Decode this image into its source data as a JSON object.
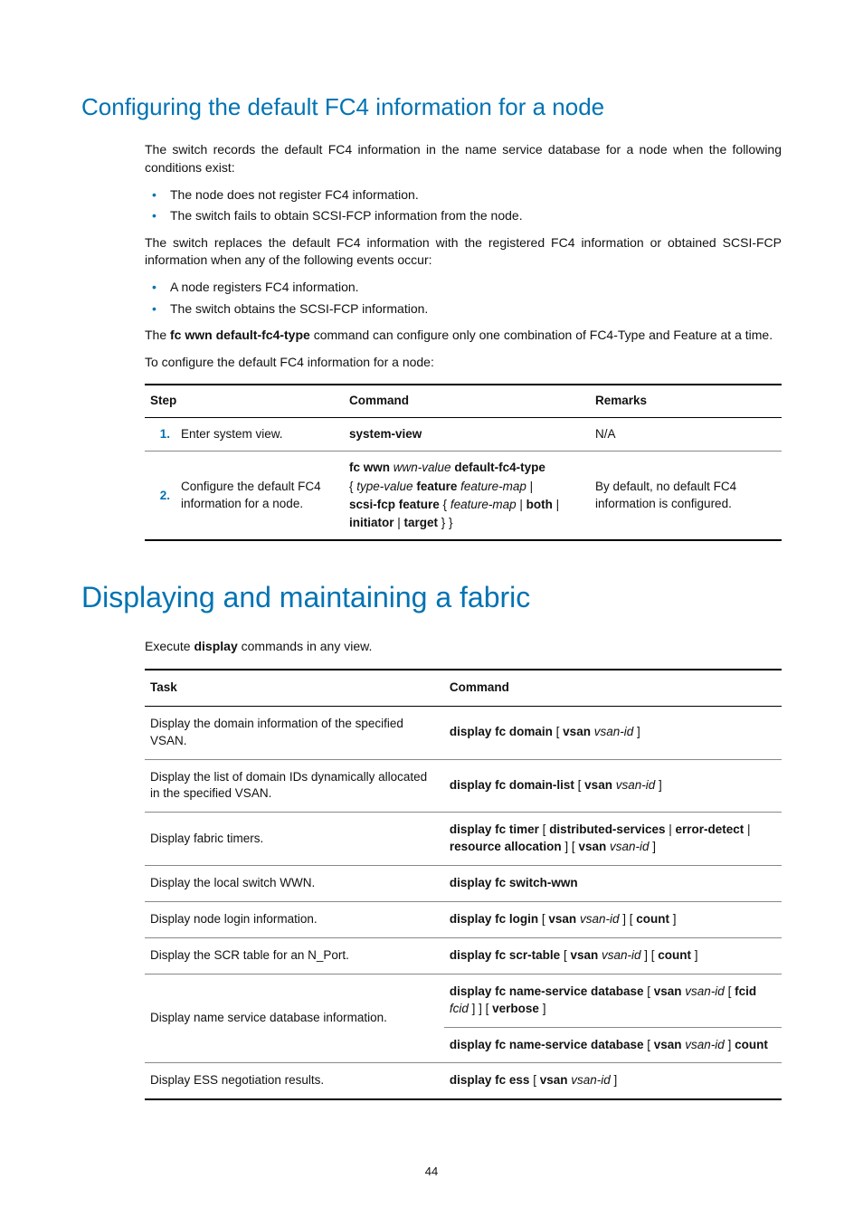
{
  "section1": {
    "title": "Configuring the default FC4 information for a node",
    "p1": "The switch records the default FC4 information in the name service database for a node when the following conditions exist:",
    "b1": "The node does not register FC4 information.",
    "b2": "The switch fails to obtain SCSI-FCP information from the node.",
    "p2": "The switch replaces the default FC4 information with the registered FC4 information or obtained SCSI-FCP information when any of the following events occur:",
    "b3": "A node registers FC4 information.",
    "b4": "The switch obtains the SCSI-FCP information.",
    "p3a": "The ",
    "p3b": "fc wwn default-fc4-type",
    "p3c": " command can configure only one combination of FC4-Type and Feature at a time.",
    "p4": "To configure the default FC4 information for a node:",
    "table": {
      "h1": "Step",
      "h2": "Command",
      "h3": "Remarks",
      "r1": {
        "num": "1.",
        "desc": "Enter system view.",
        "cmd": "system-view",
        "rem": "N/A"
      },
      "r2": {
        "num": "2.",
        "desc": "Configure the default FC4 information for a node.",
        "rem": "By default, no default FC4 information is configured."
      }
    }
  },
  "section2": {
    "title": "Displaying and maintaining a fabric",
    "p1a": "Execute ",
    "p1b": "display",
    "p1c": " commands in any view.",
    "table": {
      "h1": "Task",
      "h2": "Command",
      "rows": {
        "r1": "Display the domain information of the specified VSAN.",
        "r2": "Display the list of domain IDs dynamically allocated in the specified VSAN.",
        "r3": "Display fabric timers.",
        "r4": "Display the local switch WWN.",
        "r5": "Display node login information.",
        "r6": "Display the SCR table for an N_Port.",
        "r7": "Display name service database information.",
        "r8": "Display ESS negotiation results."
      }
    }
  },
  "page": "44"
}
